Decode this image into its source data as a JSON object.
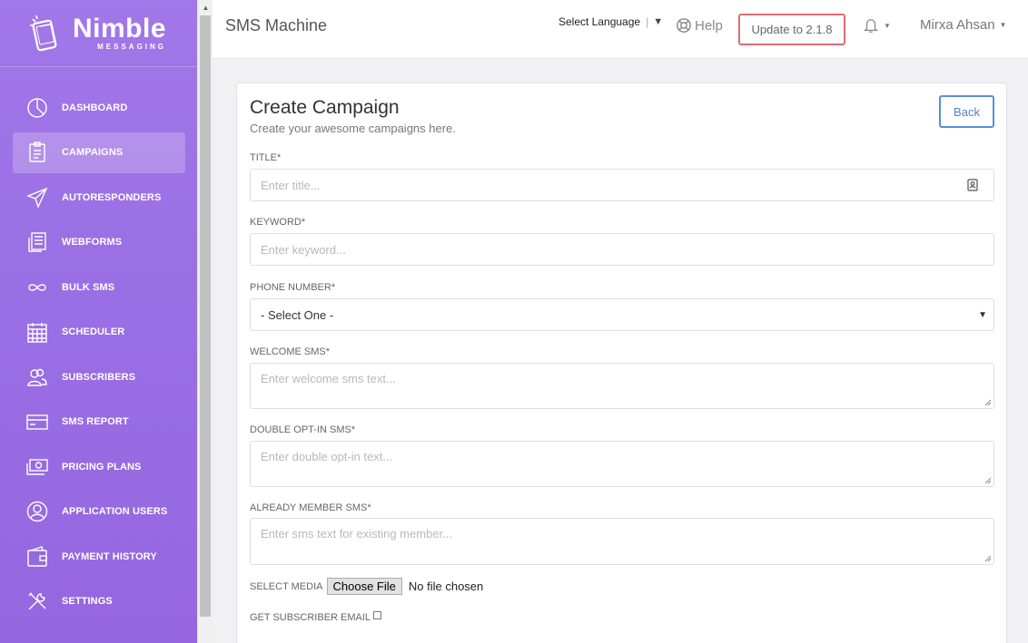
{
  "sidebar": {
    "logo": {
      "name": "Nimble",
      "sub": "MESSAGING"
    },
    "items": [
      {
        "label": "DASHBOARD",
        "icon": "dashboard-icon",
        "active": false
      },
      {
        "label": "CAMPAIGNS",
        "icon": "campaigns-icon",
        "active": true
      },
      {
        "label": "AUTORESPONDERS",
        "icon": "paper-plane-icon",
        "active": false
      },
      {
        "label": "WEBFORMS",
        "icon": "webforms-icon",
        "active": false
      },
      {
        "label": "BULK SMS",
        "icon": "infinity-icon",
        "active": false
      },
      {
        "label": "SCHEDULER",
        "icon": "calendar-icon",
        "active": false
      },
      {
        "label": "SUBSCRIBERS",
        "icon": "users-icon",
        "active": false
      },
      {
        "label": "SMS REPORT",
        "icon": "card-icon",
        "active": false
      },
      {
        "label": "PRICING PLANS",
        "icon": "money-icon",
        "active": false
      },
      {
        "label": "APPLICATION USERS",
        "icon": "user-circle-icon",
        "active": false
      },
      {
        "label": "PAYMENT HISTORY",
        "icon": "wallet-icon",
        "active": false
      },
      {
        "label": "SETTINGS",
        "icon": "tools-icon",
        "active": false
      }
    ]
  },
  "header": {
    "title": "SMS Machine",
    "language": "Select Language",
    "help": "Help",
    "update": "Update to 2.1.8",
    "user": "Mirxa Ahsan"
  },
  "form": {
    "title": "Create Campaign",
    "subtitle": "Create your awesome campaigns here.",
    "back": "Back",
    "title_label": "TITLE*",
    "title_placeholder": "Enter title...",
    "keyword_label": "KEYWORD*",
    "keyword_placeholder": "Enter keyword...",
    "phone_label": "PHONE NUMBER*",
    "phone_value": "- Select One -",
    "welcome_label": "WELCOME SMS*",
    "welcome_placeholder": "Enter welcome sms text...",
    "optin_label": "DOUBLE OPT-IN SMS*",
    "optin_placeholder": "Enter double opt-in text...",
    "member_label": "ALREADY MEMBER SMS*",
    "member_placeholder": "Enter sms text for existing member...",
    "media_label": "SELECT MEDIA",
    "file_button": "Choose File",
    "file_status": "No file chosen",
    "email_label": "GET SUBSCRIBER EMAIL"
  },
  "colors": {
    "sidebar": "#9a6ee4",
    "update_border": "#e06b77",
    "back_border": "#5b8dd9"
  }
}
